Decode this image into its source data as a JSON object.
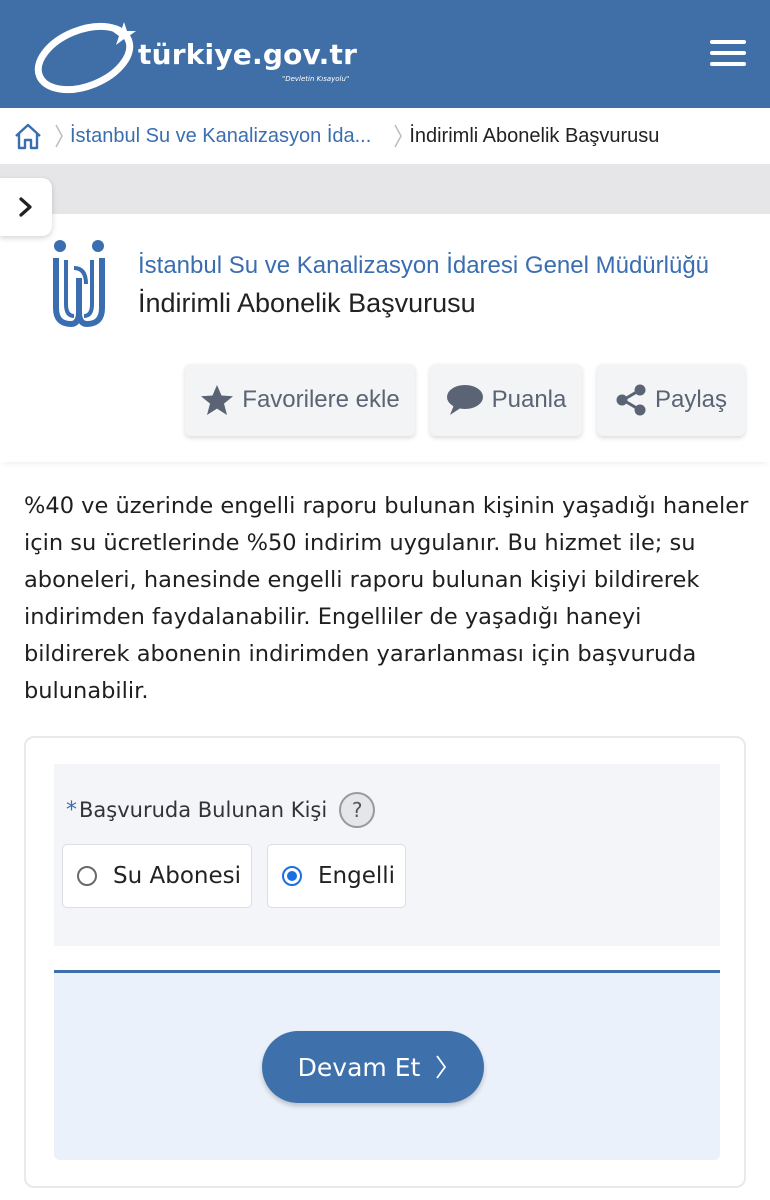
{
  "header": {
    "logo_text": "türkiye.gov.tr",
    "logo_tagline": "\"Devletin Kısayolu\"",
    "menu_icon": "hamburger-menu-icon"
  },
  "breadcrumb": {
    "home_icon": "home-icon",
    "items": [
      {
        "label": "İstanbul Su ve Kanalizasyon İda..."
      },
      {
        "label": "İndirimli Abonelik Başvurusu"
      }
    ]
  },
  "service": {
    "institution": "İstanbul Su ve Kanalizasyon İdaresi Genel Müdürlüğü",
    "title": "İndirimli Abonelik Başvurusu",
    "actions": {
      "favorite": "Favorilere ekle",
      "rate": "Puanla",
      "share": "Paylaş"
    }
  },
  "description": "%40 ve üzerinde engelli raporu bulunan kişinin yaşadığı haneler için su ücretlerinde %50 indirim uygulanır. Bu hizmet ile; su aboneleri, hanesinde engelli raporu bulunan kişiyi bildirerek indirimden faydalanabilir. Engelliler de yaşadığı haneyi bildirerek abonenin indirimden yararlanması için başvuruda bulunabilir.",
  "form": {
    "required_mark": "*",
    "field_label": "Başvuruda Bulunan Kişi",
    "help": "?",
    "options": [
      {
        "label": "Su Abonesi",
        "selected": false
      },
      {
        "label": "Engelli",
        "selected": true
      }
    ],
    "submit_label": "Devam Et"
  },
  "colors": {
    "brand_blue": "#3f6fa6",
    "link_blue": "#3a6eb0",
    "radio_selected": "#1a6fe3"
  }
}
